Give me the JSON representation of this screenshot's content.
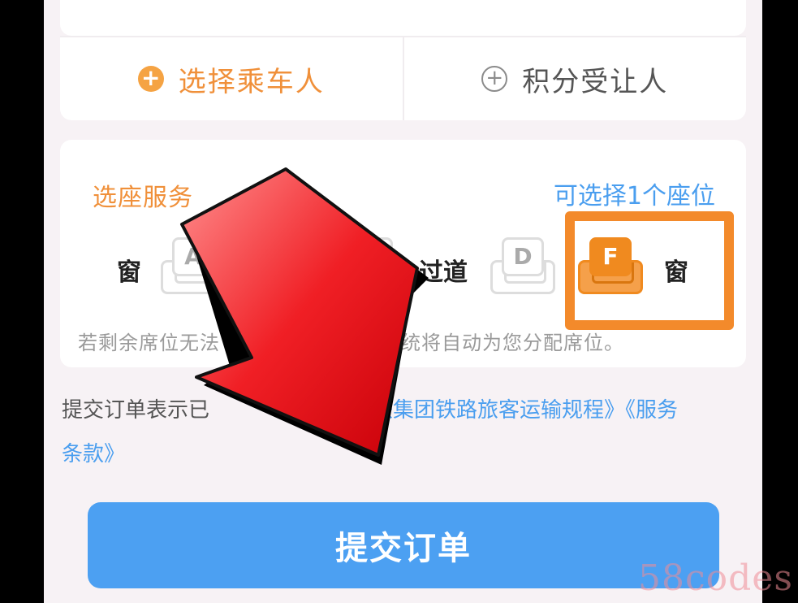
{
  "passengers": {
    "select_label": "选择乘车人",
    "points_label": "积分受让人"
  },
  "seat_service": {
    "title": "选座服务",
    "count_hint": "可选择1个座位",
    "window_left": "窗",
    "aisle": "过道",
    "window_right": "窗",
    "seats": [
      "A",
      "C",
      "D",
      "F"
    ],
    "selected_seat": "F",
    "note_start": "若剩余席位无法",
    "note_end": "系统将自动为您分配席位。"
  },
  "agreement": {
    "prefix": "提交订单表示已",
    "link_rules": "铁集团铁路旅客运输规程》《服务",
    "link_terms": "条款》"
  },
  "submit": {
    "label": "提交订单"
  },
  "watermark": "58codes",
  "colors": {
    "accent_orange": "#f0903a",
    "link_blue": "#4a9eef",
    "button_blue": "#4ca0f2",
    "arrow_red": "#e8131b"
  }
}
